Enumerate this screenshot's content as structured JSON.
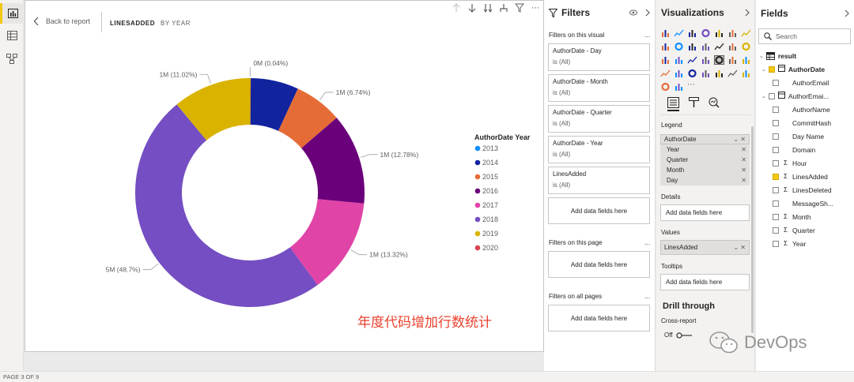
{
  "canvas": {
    "back_label": "Back to report",
    "breadcrumb": [
      "LINESADDED",
      "BY YEAR"
    ],
    "title": "年度代码增加行数统计"
  },
  "chart_data": {
    "type": "pie",
    "donut": true,
    "legend_title": "AuthorDate Year",
    "legend_position": "right",
    "categories": [
      "2013",
      "2014",
      "2015",
      "2016",
      "2017",
      "2018",
      "2019",
      "2020"
    ],
    "colors": [
      "#118dff",
      "#12239e",
      "#e66c37",
      "#6b007b",
      "#e044a7",
      "#744ec2",
      "#d9b300",
      "#d64550"
    ],
    "percentages": [
      0.0,
      6.7,
      6.74,
      12.78,
      13.32,
      48.7,
      11.02,
      0.04
    ],
    "data_labels": [
      "",
      "",
      "1M (6.74%)",
      "1M (12.78%)",
      "1M (13.32%)",
      "5M (48.7%)",
      "1M (11.02%)",
      "0M (0.04%)"
    ]
  },
  "filters": {
    "header": "Filters",
    "on_visual_label": "Filters on this visual",
    "cards": [
      {
        "name": "AuthorDate - Day",
        "value": "is (All)"
      },
      {
        "name": "AuthorDate - Month",
        "value": "is (All)"
      },
      {
        "name": "AuthorDate - Quarter",
        "value": "is (All)"
      },
      {
        "name": "AuthorDate - Year",
        "value": "is (All)"
      },
      {
        "name": "LinesAdded",
        "value": "is (All)"
      }
    ],
    "add_fields": "Add data fields here",
    "on_page_label": "Filters on this page",
    "all_pages_label": "Filters on all pages",
    "more": "..."
  },
  "visualizations": {
    "header": "Visualizations",
    "legend_label": "Legend",
    "legend_main": "AuthorDate",
    "legend_items": [
      "Year",
      "Quarter",
      "Month",
      "Day"
    ],
    "details_label": "Details",
    "values_label": "Values",
    "values_item": "LinesAdded",
    "tooltips_label": "Tooltips",
    "add_fields": "Add data fields here",
    "drill_through": "Drill through",
    "cross_report": "Cross-report",
    "toggle_state": "Off"
  },
  "fields": {
    "header": "Fields",
    "search_placeholder": "Search",
    "table": "result",
    "items": [
      {
        "label": "AuthorDate",
        "checked": true,
        "kind": "date",
        "bold": true,
        "indent": 1
      },
      {
        "label": "AuthorEmail",
        "checked": false,
        "kind": "",
        "indent": 2
      },
      {
        "label": "AuthorEmai...",
        "checked": false,
        "kind": "hier",
        "indent": 1
      },
      {
        "label": "AuthorName",
        "checked": false,
        "kind": "",
        "indent": 2
      },
      {
        "label": "CommitHash",
        "checked": false,
        "kind": "",
        "indent": 2
      },
      {
        "label": "Day Name",
        "checked": false,
        "kind": "",
        "indent": 2
      },
      {
        "label": "Domain",
        "checked": false,
        "kind": "",
        "indent": 2
      },
      {
        "label": "Hour",
        "checked": false,
        "kind": "sum",
        "indent": 2
      },
      {
        "label": "LinesAdded",
        "checked": true,
        "kind": "sum",
        "indent": 2
      },
      {
        "label": "LinesDeleted",
        "checked": false,
        "kind": "sum",
        "indent": 2
      },
      {
        "label": "MessageSh...",
        "checked": false,
        "kind": "",
        "indent": 2
      },
      {
        "label": "Month",
        "checked": false,
        "kind": "sum",
        "indent": 2
      },
      {
        "label": "Quarter",
        "checked": false,
        "kind": "sum",
        "indent": 2
      },
      {
        "label": "Year",
        "checked": false,
        "kind": "sum",
        "indent": 2
      }
    ]
  },
  "status": {
    "page": "PAGE 3 OF 9"
  },
  "watermark": "DevOps",
  "icons": {
    "chevron": "chevron-right-icon",
    "filter": "filter-icon",
    "search": "search-icon",
    "table": "table-icon"
  }
}
